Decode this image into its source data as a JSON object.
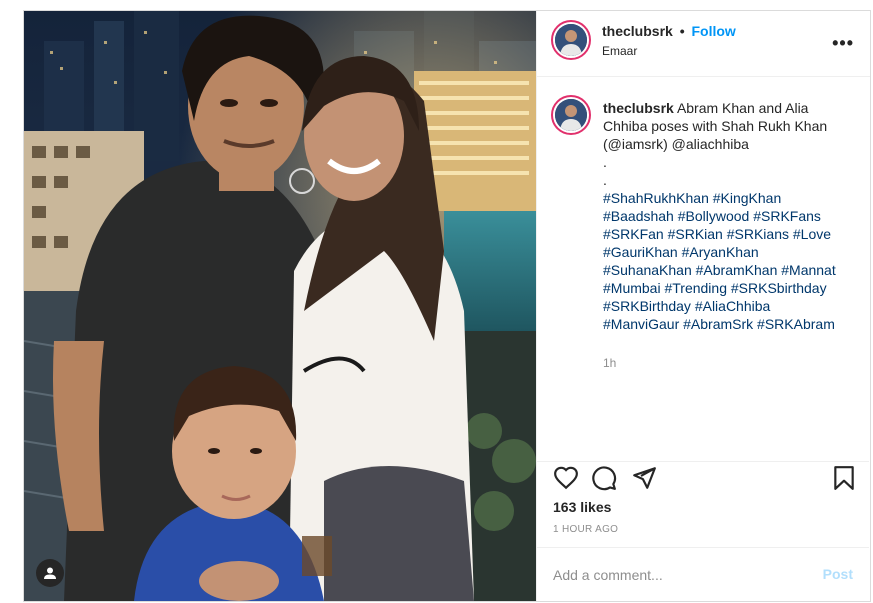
{
  "post": {
    "username": "theclubsrk",
    "follow_label": "Follow",
    "separator": "•",
    "location": "Emaar",
    "caption_intro": "Abram Khan and Alia Chhiba poses with Shah Rukh Khan (@iamsrk) @aliachhiba",
    "dots": [
      ".",
      "."
    ],
    "hashtags_lines": [
      "#ShahRukhKhan #KingKhan",
      "#Baadshah #Bollywood #SRKFans",
      "#SRKFan #SRKian #SRKians #Love",
      "#GauriKhan #AryanKhan",
      "#SuhanaKhan #AbramKhan #Mannat",
      "#Mumbai #Trending #SRKSbirthday",
      "#SRKBirthday #AliaChhiba",
      "#ManviGaur #AbramSrk #SRKAbram"
    ],
    "caption_time": "1h",
    "likes": "163 likes",
    "time_ago": "1 HOUR AGO",
    "comment_placeholder": "Add a comment...",
    "post_label": "Post",
    "more_label": "•••"
  },
  "icons": {
    "like": "heart-icon",
    "comment": "comment-icon",
    "share": "paper-plane-icon",
    "save": "bookmark-icon",
    "tag": "user-tag-icon",
    "more": "more-options-icon"
  },
  "colors": {
    "follow": "#0095f6",
    "hashtag": "#00376b",
    "post_disabled": "#b2dffc",
    "story_ring": "#e1306c"
  }
}
